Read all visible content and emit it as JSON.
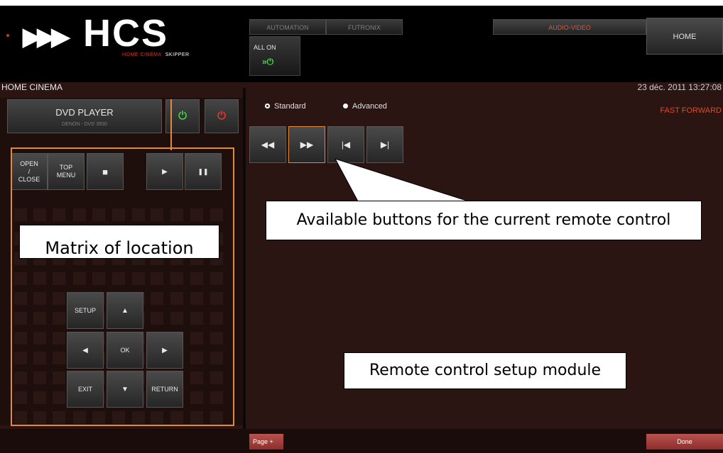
{
  "logo": {
    "name": "HCS",
    "arrows": "▶▶▶",
    "tagline_colored": "HOME CINEMA",
    "tagline_plain": "SKIPPER"
  },
  "nav": {
    "automation": "AUTOMATION",
    "futronix": "FUTRONIX",
    "audio_video": "AUDIO-VIDEO",
    "home": "HOME"
  },
  "all_on": {
    "label": "ALL ON",
    "icon": "power-arrows-icon"
  },
  "section_title": "HOME CINEMA",
  "datetime": "23 déc. 2011  13:27:08",
  "device": {
    "name": "DVD PLAYER",
    "model": "DENON - DVD 3930",
    "power_on_color": "#3fd13f",
    "power_off_color": "#e8332a"
  },
  "remote_buttons": {
    "open_close": "OPEN\n/\nCLOSE",
    "top_menu": "TOP\nMENU",
    "stop": "■",
    "play": "▶",
    "pause": "❚❚",
    "setup": "SETUP",
    "up": "▲",
    "left": "◀",
    "ok": "OK",
    "right": "▶",
    "exit": "EXIT",
    "down": "▼",
    "return": "RETURN"
  },
  "modes": {
    "standard": "Standard",
    "advanced": "Advanced",
    "selected": "Standard"
  },
  "current_action": "FAST FORWARD",
  "available_buttons": [
    {
      "name": "rewind",
      "glyph": "◀◀"
    },
    {
      "name": "fast-forward",
      "glyph": "▶▶"
    },
    {
      "name": "previous",
      "glyph": "|◀"
    },
    {
      "name": "next",
      "glyph": "▶|"
    }
  ],
  "callouts": {
    "available": "Available buttons for the current remote control",
    "matrix": "Matrix of location",
    "module": "Remote control setup module"
  },
  "bottom": {
    "page_plus": "Page +",
    "done": "Done"
  },
  "colors": {
    "accent_orange": "#e08a3a",
    "audio_video_active": "#d55a3a",
    "panel_bg": "#2a1512"
  }
}
